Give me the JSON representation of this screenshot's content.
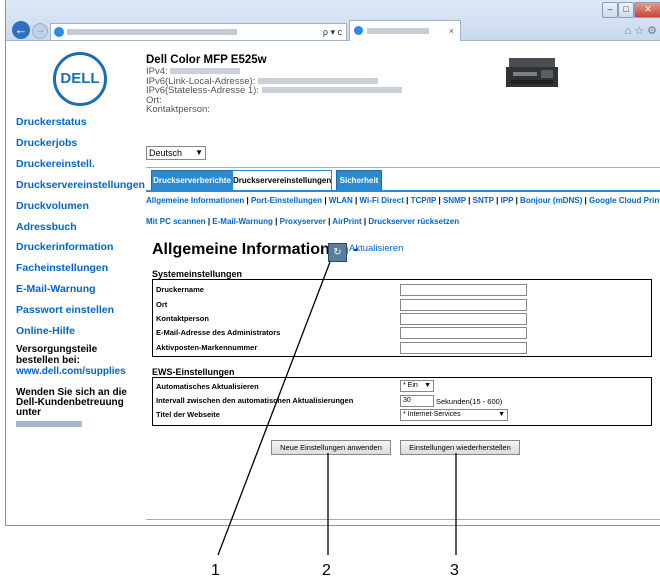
{
  "browser": {
    "tab_close": "×",
    "address_controls": "ρ ▾ c",
    "tools": "⌂ ☆ ⚙"
  },
  "printer": {
    "model": "Dell Color MFP E525w",
    "ipv4_label": "IPv4:",
    "ipv6_link_label": "IPv6(Link-Local-Adresse):",
    "ipv6_stateless_label": "IPv6(Stateless-Adresse 1):",
    "ort_label": "Ort:",
    "kontakt_label": "Kontaktperson:"
  },
  "logo_text": "DELL",
  "nav": {
    "items": [
      "Druckerstatus",
      "Druckerjobs",
      "Druckereinstell.",
      "Druckservereinstellungen",
      "Druckvolumen",
      "Adressbuch",
      "Druckerinformation",
      "Facheinstellungen",
      "E-Mail-Warnung",
      "Passwort einstellen",
      "Online-Hilfe"
    ],
    "supplies_text": "Versorgungsteile bestellen bei:",
    "supplies_link": "www.dell.com/supplies",
    "contact_text": "Wenden Sie sich an die Dell-Kundenbetreuung unter"
  },
  "language": "Deutsch",
  "tabs": [
    "Druckserverberichte",
    "Druckservereinstellungen",
    "Sicherheit"
  ],
  "subnav_row1": [
    "Allgemeine Informationen",
    "Port-Einstellungen",
    "WLAN",
    "Wi-Fi Direct",
    "TCP/IP",
    "SNMP",
    "SNTP",
    "IPP",
    "Bonjour (mDNS)",
    "Google Cloud Print"
  ],
  "subnav_row2": [
    "Mit PC scannen",
    "E-Mail-Warnung",
    "Proxyserver",
    "AirPrint",
    "Druckserver rücksetzen"
  ],
  "page_title": "Allgemeine Informationen -",
  "refresh_label": "Aktualisieren",
  "system_settings": {
    "title": "Systemeinstellungen",
    "rows": [
      "Druckername",
      "Ort",
      "Kontaktperson",
      "E-Mail-Adresse des Administrators",
      "Aktivposten-Markennummer"
    ]
  },
  "ews_settings": {
    "title": "EWS-Einstellungen",
    "auto_refresh_label": "Automatisches Aktualisieren",
    "auto_refresh_value": "* Ein",
    "interval_label": "Intervall zwischen den automatischen Aktualisierungen",
    "interval_value": "30",
    "interval_unit": "Sekunden(15 - 600)",
    "title_label": "Titel der Webseite",
    "title_value": "* Internet-Services"
  },
  "buttons": {
    "apply": "Neue Einstellungen anwenden",
    "restore": "Einstellungen wiederherstellen"
  },
  "callouts": [
    "1",
    "2",
    "3"
  ]
}
